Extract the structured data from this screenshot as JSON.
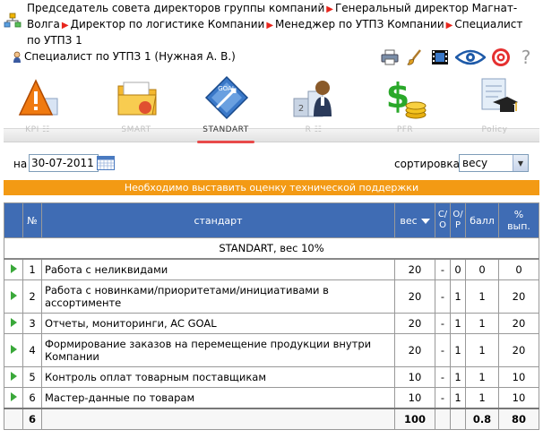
{
  "breadcrumb": {
    "items": [
      "Председатель совета директоров группы компаний",
      "Генеральный директор Магнат-Волга",
      "Директор по логистике Компании",
      "Менеджер по УТПЗ Компании",
      "Специалист по УТПЗ 1"
    ]
  },
  "user": {
    "text": "Специалист по УТПЗ 1  (Нужная А. В.)"
  },
  "tools": [
    "printer-icon",
    "brush-icon",
    "film-icon",
    "eye-icon",
    "target-icon",
    "help-icon"
  ],
  "tools_help": "?",
  "modules": [
    {
      "label": "KPI",
      "icon": "warning-icon"
    },
    {
      "label": "SMART",
      "icon": "folder-icon"
    },
    {
      "label": "STANDART",
      "icon": "goal-icon",
      "active": true
    },
    {
      "label": "R",
      "icon": "podium-icon"
    },
    {
      "label": "PFR",
      "icon": "money-icon"
    },
    {
      "label": "Policy",
      "icon": "graduation-icon"
    }
  ],
  "filter": {
    "date_label": "на",
    "date_value": "30-07-2011",
    "sort_label": "сортировка:",
    "sort_value": "весу"
  },
  "banner": "Необходимо выставить оценку технической поддержки",
  "table": {
    "headers": {
      "num": "№",
      "standard": "стандарт",
      "weight": "вес",
      "so": "С/ О",
      "op": "О/ Р",
      "score": "балл",
      "pct": "% вып."
    },
    "section": "STANDART, вес 10%",
    "rows": [
      {
        "n": "1",
        "name": "Работа с неликвидами",
        "weight": "20",
        "so": "-",
        "op": "0",
        "score": "0",
        "pct": "0"
      },
      {
        "n": "2",
        "name": "Работа с новинками/приоритетами/инициативами в ассортименте",
        "weight": "20",
        "so": "-",
        "op": "1",
        "score": "1",
        "pct": "20"
      },
      {
        "n": "3",
        "name": "Отчеты, мониторинги, AC GOAL",
        "weight": "20",
        "so": "-",
        "op": "1",
        "score": "1",
        "pct": "20"
      },
      {
        "n": "4",
        "name": "Формирование заказов на перемещение продукции внутри Компании",
        "weight": "20",
        "so": "-",
        "op": "1",
        "score": "1",
        "pct": "20"
      },
      {
        "n": "5",
        "name": "Контроль оплат товарным поставщикам",
        "weight": "10",
        "so": "-",
        "op": "1",
        "score": "1",
        "pct": "10"
      },
      {
        "n": "6",
        "name": "Мастер-данные по товарам",
        "weight": "10",
        "so": "-",
        "op": "1",
        "score": "1",
        "pct": "10"
      }
    ],
    "total": {
      "n": "6",
      "weight": "100",
      "score": "0.8",
      "pct": "80"
    }
  }
}
